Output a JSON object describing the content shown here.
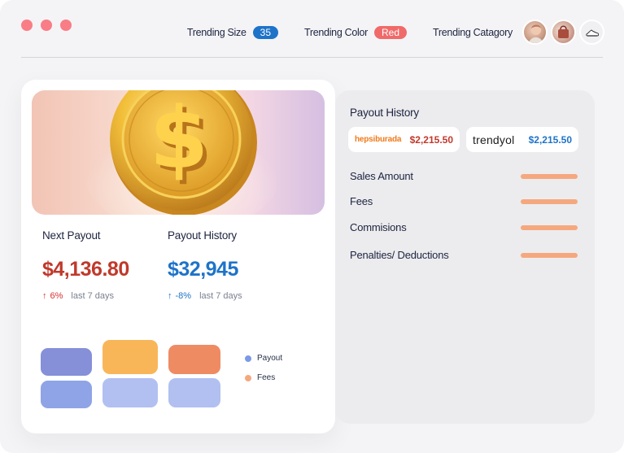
{
  "colors": {
    "accent_blue": "#1e73c9",
    "accent_red": "#d93131",
    "window_dot": "#f97d86",
    "bar_orange": "#f5a87e"
  },
  "topbar": {
    "trending_size": {
      "label": "Trending Size",
      "value": "35"
    },
    "trending_color": {
      "label": "Trending Color",
      "value": "Red"
    },
    "trending_category": {
      "label": "Trending Catagory"
    },
    "thumbnails": [
      "model-photo",
      "bag-photo",
      "sneaker-icon"
    ]
  },
  "hero": {
    "icon": "dollar-coin-icon"
  },
  "stats": {
    "next_payout": {
      "title": "Next Payout",
      "value": "$4,136.80",
      "change": "6%",
      "period": "last 7 days",
      "direction": "up"
    },
    "payout_history": {
      "title": "Payout History",
      "value": "$32,945",
      "change": "-8%",
      "period": "last 7 days",
      "direction": "up"
    }
  },
  "legend": [
    {
      "label": "Payout",
      "color": "#7b99e6"
    },
    {
      "label": "Fees",
      "color": "#f5a87e"
    }
  ],
  "right_panel": {
    "title": "Payout History",
    "stores": [
      {
        "name": "hepsiburada",
        "amount": "$2,215.50",
        "name_color": "#f07a1a",
        "amount_color": "#c0392b"
      },
      {
        "name": "trendyol",
        "amount": "$2,215.50",
        "name_color": "#1d1d1f",
        "amount_color": "#1e73c9"
      }
    ],
    "rows": [
      {
        "label": "Sales Amount"
      },
      {
        "label": "Fees"
      },
      {
        "label": "Commisions"
      },
      {
        "label": "Penalties/ Deductions"
      }
    ]
  }
}
